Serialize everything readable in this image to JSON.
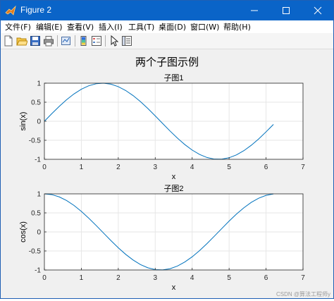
{
  "window": {
    "title": "Figure 2"
  },
  "menu": [
    "文件(F)",
    "编辑(E)",
    "查看(V)",
    "插入(I)",
    "工具(T)",
    "桌面(D)",
    "窗口(W)",
    "帮助(H)"
  ],
  "toolbar": {
    "buttons": [
      "new-figure-icon",
      "open-file-icon",
      "save-icon",
      "print-icon",
      "link-plot-icon",
      "insert-colorbar-icon",
      "insert-legend-icon",
      "pointer-icon",
      "property-inspector-icon"
    ]
  },
  "figure": {
    "suptitle": "两个子图示例"
  },
  "watermark": "CSDN @算法工程师y",
  "chart_data": [
    {
      "type": "line",
      "title": "子图1",
      "xlabel": "x",
      "ylabel": "sin(x)",
      "xlim": [
        0,
        7
      ],
      "ylim": [
        -1,
        1
      ],
      "xticks": [
        "0",
        "1",
        "2",
        "3",
        "4",
        "5",
        "6",
        "7"
      ],
      "yticks": [
        "-1",
        "-0.5",
        "0",
        "0.5",
        "1"
      ],
      "grid": true,
      "series_color": "#0072bd",
      "x": [
        0,
        0.2,
        0.4,
        0.6,
        0.8,
        1.0,
        1.2,
        1.4,
        1.6,
        1.8,
        2.0,
        2.2,
        2.4,
        2.6,
        2.8,
        3.0,
        3.2,
        3.4,
        3.6,
        3.8,
        4.0,
        4.2,
        4.4,
        4.6,
        4.8,
        5.0,
        5.2,
        5.4,
        5.6,
        5.8,
        6.0,
        6.2
      ],
      "y": [
        0,
        0.199,
        0.389,
        0.565,
        0.717,
        0.841,
        0.932,
        0.985,
        1.0,
        0.974,
        0.909,
        0.808,
        0.675,
        0.516,
        0.335,
        0.141,
        -0.058,
        -0.256,
        -0.443,
        -0.612,
        -0.757,
        -0.872,
        -0.952,
        -0.994,
        -0.996,
        -0.959,
        -0.883,
        -0.773,
        -0.631,
        -0.465,
        -0.279,
        -0.083
      ]
    },
    {
      "type": "line",
      "title": "子图2",
      "xlabel": "x",
      "ylabel": "cos(x)",
      "xlim": [
        0,
        7
      ],
      "ylim": [
        -1,
        1
      ],
      "xticks": [
        "0",
        "1",
        "2",
        "3",
        "4",
        "5",
        "6",
        "7"
      ],
      "yticks": [
        "-1",
        "-0.5",
        "0",
        "0.5",
        "1"
      ],
      "grid": true,
      "series_color": "#0072bd",
      "x": [
        0,
        0.2,
        0.4,
        0.6,
        0.8,
        1.0,
        1.2,
        1.4,
        1.6,
        1.8,
        2.0,
        2.2,
        2.4,
        2.6,
        2.8,
        3.0,
        3.2,
        3.4,
        3.6,
        3.8,
        4.0,
        4.2,
        4.4,
        4.6,
        4.8,
        5.0,
        5.2,
        5.4,
        5.6,
        5.8,
        6.0,
        6.2
      ],
      "y": [
        1.0,
        0.98,
        0.921,
        0.825,
        0.697,
        0.54,
        0.362,
        0.17,
        -0.029,
        -0.227,
        -0.416,
        -0.589,
        -0.737,
        -0.857,
        -0.942,
        -0.99,
        -0.998,
        -0.967,
        -0.897,
        -0.791,
        -0.654,
        -0.49,
        -0.307,
        -0.112,
        0.087,
        0.284,
        0.469,
        0.635,
        0.776,
        0.886,
        0.96,
        0.997
      ]
    }
  ]
}
